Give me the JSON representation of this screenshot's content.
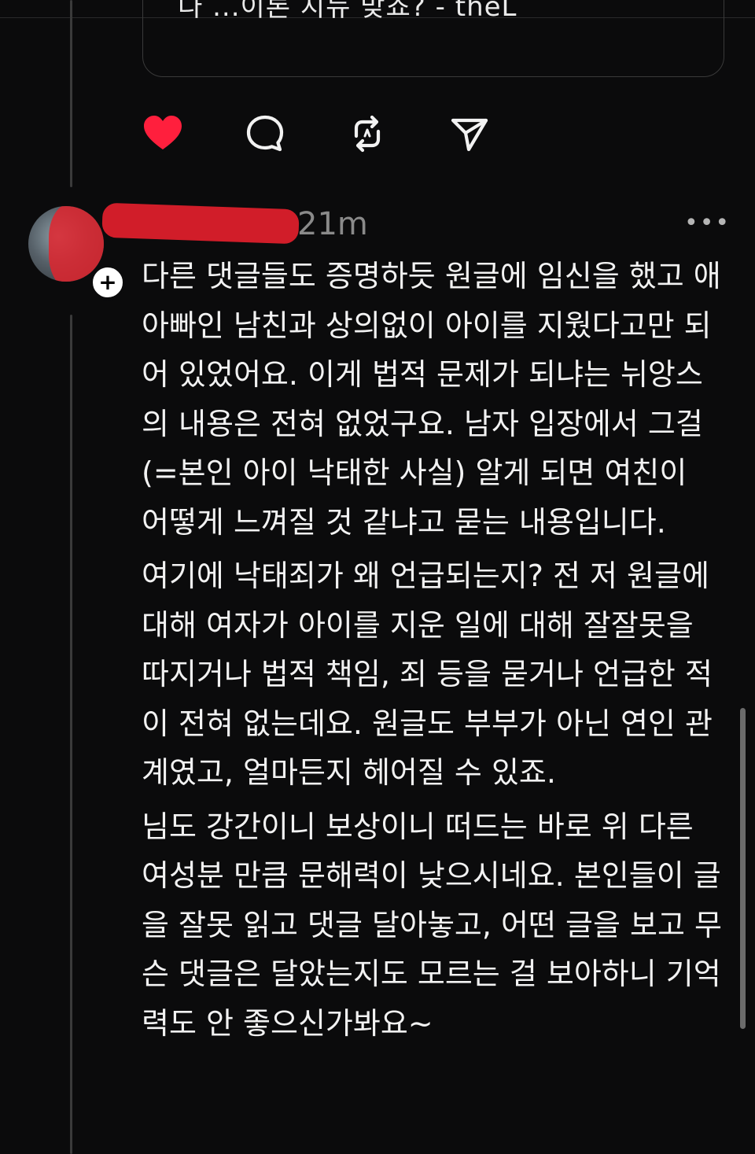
{
  "quote_card": {
    "text": "다 ...이론 지뉴 맞죠? - theL"
  },
  "actions": {
    "like_icon": "heart-icon",
    "comment_icon": "comment-bubble-icon",
    "repost_icon": "repost-icon",
    "share_icon": "send-icon",
    "like_color": "#ff1f3d"
  },
  "comment": {
    "timestamp": "21m",
    "more_label": "•••",
    "follow_badge": "+",
    "paragraphs": [
      "다른 댓글들도 증명하듯 원글에 임신을 했고 애아빠인 남친과 상의없이 아이를 지웠다고만 되어 있었어요. 이게 법적 문제가 되냐는 뉘앙스의 내용은 전혀 없었구요. 남자 입장에서 그걸(=본인 아이 낙태한 사실) 알게 되면 여친이 어떻게 느껴질 것 같냐고 묻는 내용입니다.",
      "여기에 낙태죄가 왜 언급되는지? 전 저 원글에 대해 여자가 아이를 지운 일에 대해 잘잘못을 따지거나 법적 책임, 죄 등을 묻거나 언급한 적이 전혀 없는데요. 원글도 부부가 아닌 연인 관계였고, 얼마든지 헤어질 수 있죠.",
      "님도 강간이니 보상이니 떠드는 바로 위 다른 여성분 만큼 문해력이 낮으시네요. 본인들이 글을 잘못 읽고 댓글 달아놓고, 어떤 글을 보고 무슨 댓글은 달았는지도 모르는 걸 보아하니 기억력도 안 좋으신가봐요~"
    ]
  }
}
